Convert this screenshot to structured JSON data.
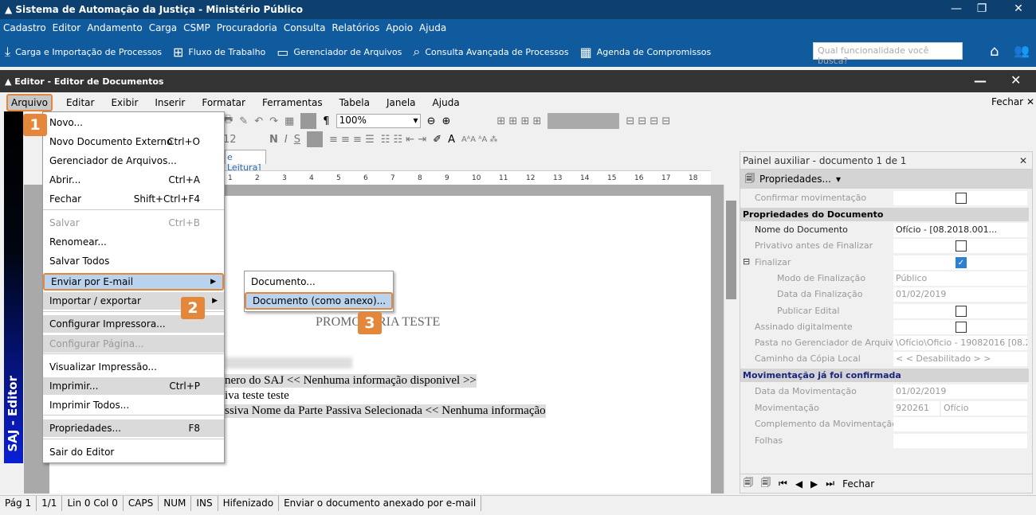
{
  "app": {
    "title": "Sistema de Automação da Justiça - Ministério Público",
    "menu": [
      "Cadastro",
      "Editor",
      "Andamento",
      "Carga",
      "CSMP",
      "Procuradoria",
      "Consulta",
      "Relatórios",
      "Apoio",
      "Ajuda"
    ],
    "tools": [
      {
        "icon": "download-icon",
        "label": "Carga e Importação de Processos"
      },
      {
        "icon": "workflow-icon",
        "label": "Fluxo de Trabalho"
      },
      {
        "icon": "folder-icon",
        "label": "Gerenciador de Arquivos"
      },
      {
        "icon": "search-doc-icon",
        "label": "Consulta Avançada de Processos"
      },
      {
        "icon": "calendar-icon",
        "label": "Agenda de Compromissos"
      }
    ],
    "search_placeholder": "Qual funcionalidade você busca?"
  },
  "editor": {
    "title": "Editor - Editor de Documentos",
    "menu": [
      "Arquivo",
      "Editar",
      "Exibir",
      "Inserir",
      "Formatar",
      "Ferramentas",
      "Tabela",
      "Janela",
      "Ajuda"
    ],
    "close_label": "Fechar",
    "zoom": "100%",
    "font_size": "12",
    "tab_label": "e Leitura]",
    "ruler": [
      "1",
      "2",
      "3",
      "4",
      "5",
      "6",
      "7",
      "8",
      "9",
      "10",
      "11",
      "12",
      "13",
      "14",
      "15",
      "16",
      "17",
      "18"
    ],
    "strip_label": "SAJ - Editor"
  },
  "file_menu": [
    {
      "label": "Novo...",
      "shortcut": ""
    },
    {
      "label": "Novo Documento Externo",
      "shortcut": "Ctrl+O"
    },
    {
      "label": "Gerenciador de Arquivos...",
      "shortcut": ""
    },
    {
      "label": "Abrir...",
      "shortcut": "Ctrl+A"
    },
    {
      "label": "Fechar",
      "shortcut": "Shift+Ctrl+F4"
    },
    {
      "label": "Salvar",
      "shortcut": "Ctrl+B"
    },
    {
      "label": "Renomear...",
      "shortcut": ""
    },
    {
      "label": "Salvar Todos",
      "shortcut": ""
    },
    {
      "label": "Enviar por E-mail",
      "shortcut": ""
    },
    {
      "label": "Importar / exportar",
      "shortcut": ""
    },
    {
      "label": "Configurar Impressora...",
      "shortcut": ""
    },
    {
      "label": "Configurar Página...",
      "shortcut": ""
    },
    {
      "label": "Visualizar Impressão...",
      "shortcut": ""
    },
    {
      "label": "Imprimir...",
      "shortcut": "Ctrl+P"
    },
    {
      "label": "Imprimir Todos...",
      "shortcut": ""
    },
    {
      "label": "Propriedades...",
      "shortcut": "F8"
    },
    {
      "label": "Sair do Editor",
      "shortcut": ""
    }
  ],
  "email_submenu": [
    "Documento...",
    "Documento (como anexo)..."
  ],
  "badges": [
    "1",
    "2",
    "3"
  ],
  "document": {
    "heading": "PROMOTORIA TESTE",
    "lines": [
      "nero do SAJ << Nenhuma informação disponivel >>",
      "iva teste teste",
      "ssiva Nome da Parte Passiva Selecionada << Nenhuma informação"
    ]
  },
  "panel": {
    "title": "Painel auxiliar - documento 1 de 1",
    "tool": "Propriedades...",
    "confirm": "Confirmar movimentação",
    "section1": "Propriedades do Documento",
    "rows": [
      {
        "label": "Nome do Documento",
        "value": "Ofício -             [08.2018.001..."
      },
      {
        "label": "Privativo antes de Finalizar",
        "check": false
      },
      {
        "label": "Finalizar",
        "check": true
      },
      {
        "label": "Modo de Finalização",
        "value": "Público"
      },
      {
        "label": "Data da Finalização",
        "value": "01/02/2019"
      },
      {
        "label": "Publicar Edital",
        "check": false
      },
      {
        "label": "Assinado digitalmente",
        "check": false
      },
      {
        "label": "Pasta no Gerenciador de Arquiv...",
        "value": "\\Ofício\\Oficio - 19082016 [08.2..."
      },
      {
        "label": "Caminho da Cópia Local",
        "value": "< < Desabilitado > >"
      }
    ],
    "section2": "Movimentação já foi confirmada",
    "rows2": [
      {
        "label": "Data da Movimentação",
        "value": "01/02/2019"
      },
      {
        "label": "Movimentação",
        "value": "920261",
        "value2": "Ofício"
      },
      {
        "label": "Complemento da Movimentação",
        "value": ""
      },
      {
        "label": "Folhas",
        "value": ""
      }
    ],
    "footer_close": "Fechar"
  },
  "status": [
    "Pág 1",
    "1/1",
    "Lin 0  Col 0",
    "CAPS",
    "NUM",
    "INS",
    "Hifenizado",
    "Enviar o documento anexado por e-mail"
  ],
  "colors": {
    "title_bar": "#0d3f6f",
    "app_blue": "#105a9e",
    "callout": "#e5873a",
    "highlight": "#b9d3ee"
  }
}
